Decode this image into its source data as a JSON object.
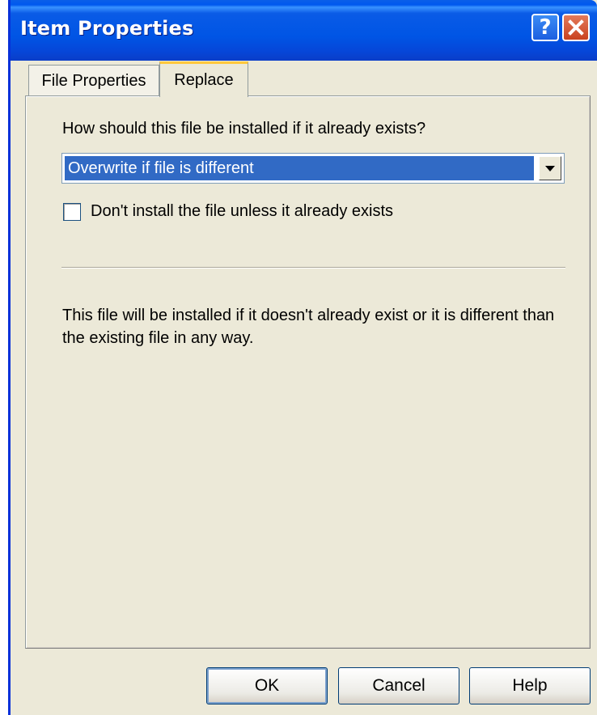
{
  "window": {
    "title": "Item Properties",
    "help_glyph": "?",
    "close_glyph": "✕",
    "colors": {
      "titlebar": "#0055E5",
      "background": "#ECE9D8",
      "selection": "#316AC5",
      "tab_highlight": "#FFC83C"
    }
  },
  "tabs": [
    {
      "label": "File Properties",
      "active": false
    },
    {
      "label": "Replace",
      "active": true
    }
  ],
  "replace": {
    "question": "How should this file be installed if it already exists?",
    "dropdown_value": "Overwrite if file is different",
    "checkbox_label": "Don't install the file unless it already exists",
    "checkbox_checked": false,
    "description": "This file will be installed if it doesn't already exist or it is different than the existing file in any way."
  },
  "buttons": {
    "ok": "OK",
    "cancel": "Cancel",
    "help": "Help"
  },
  "icons": {
    "help": "help-icon",
    "close": "close-icon",
    "dropdown": "chevron-down-icon"
  }
}
